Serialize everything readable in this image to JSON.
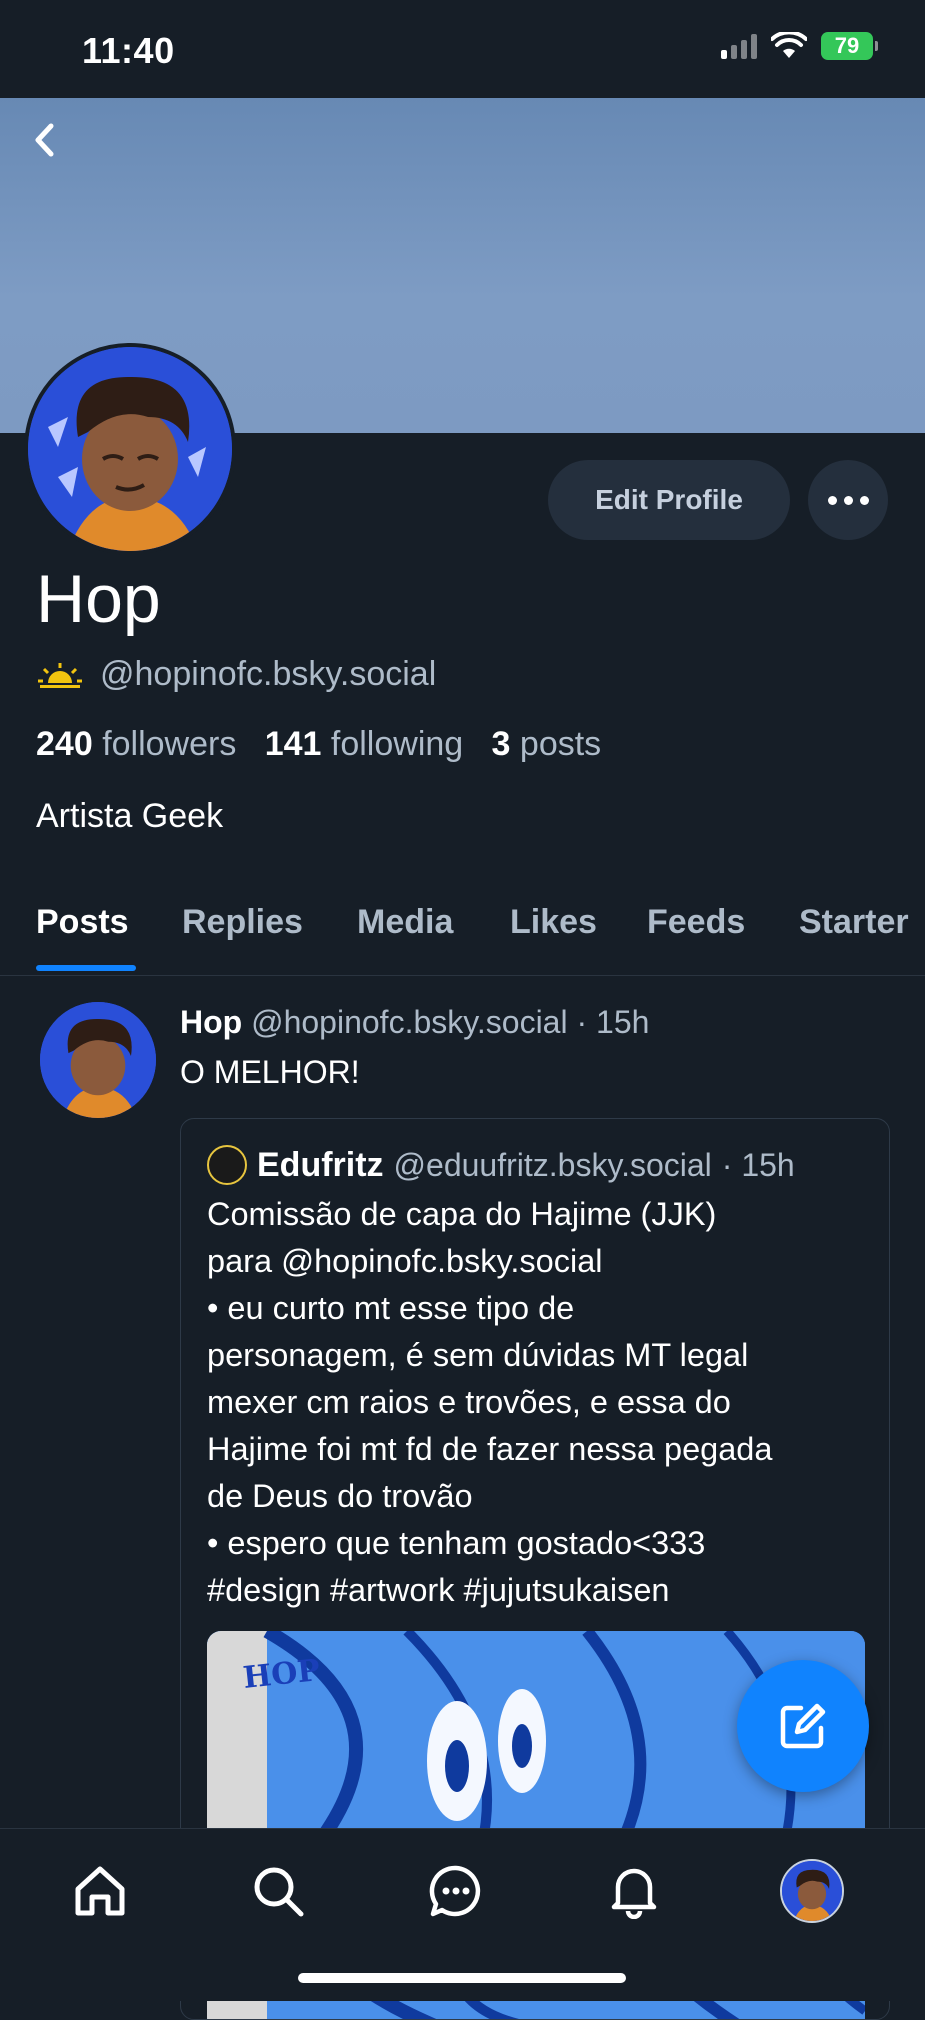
{
  "status_bar": {
    "time": "11:40",
    "battery": "79"
  },
  "profile": {
    "name": "Hop",
    "handle": "@hopinofc.bsky.social",
    "handle_icon": "sun-icon",
    "followers_count": "240",
    "followers_label": "followers",
    "following_count": "141",
    "following_label": "following",
    "posts_count": "3",
    "posts_label": "posts",
    "bio": "Artista Geek",
    "edit_label": "Edit Profile",
    "banner_color": "#7393bd"
  },
  "tabs": [
    "Posts",
    "Replies",
    "Media",
    "Likes",
    "Feeds",
    "Starter"
  ],
  "post": {
    "author": "Hop",
    "handle": "@hopinofc.bsky.social",
    "time": "· 15h",
    "text": "O MELHOR!",
    "quote": {
      "author": "Edufritz",
      "handle": "@eduufritz.bsky.social",
      "time": "· 15h",
      "lines": [
        "Comissão de capa do Hajime (JJK)",
        "para @hopinofc.bsky.social",
        "• eu curto mt esse tipo de",
        "personagem, é sem dúvidas MT legal",
        "mexer cm raios e trovões, e essa do",
        "Hajime foi mt fd de fazer nessa pegada",
        "de Deus do trovão",
        "• espero que tenham gostado<333",
        "#design #artwork #jujutsukaisen"
      ],
      "image_text": "HOP"
    }
  },
  "nav": [
    "home-icon",
    "search-icon",
    "chat-icon",
    "bell-icon",
    "profile-avatar"
  ],
  "colors": {
    "accent": "#1083fe",
    "background": "#161e27",
    "muted": "#aebbc9",
    "battery": "#34c759"
  }
}
